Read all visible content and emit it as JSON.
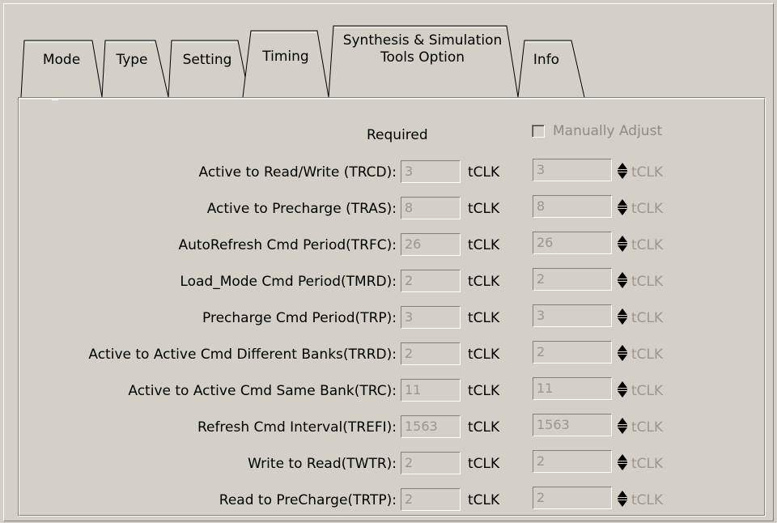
{
  "tabs": [
    {
      "label": "Mode"
    },
    {
      "label": "Type"
    },
    {
      "label": "Setting"
    },
    {
      "label": "Timing"
    },
    {
      "label_line1": "Synthesis & Simulation",
      "label_line2": "Tools Option"
    },
    {
      "label": "Info"
    }
  ],
  "active_tab": "Timing",
  "header": {
    "required_label": "Required",
    "manual_adjust_label": "Manually Adjust",
    "manual_adjust_checked": false
  },
  "rows": [
    {
      "label": "Active to Read/Write (TRCD):",
      "required": "3",
      "unit": "tCLK",
      "adjust": "3",
      "adjust_unit": "tCLK"
    },
    {
      "label": "Active to Precharge (TRAS):",
      "required": "8",
      "unit": "tCLK",
      "adjust": "8",
      "adjust_unit": "tCLK"
    },
    {
      "label": "AutoRefresh Cmd Period(TRFC):",
      "required": "26",
      "unit": "tCLK",
      "adjust": "26",
      "adjust_unit": "tCLK"
    },
    {
      "label": "Load_Mode Cmd Period(TMRD):",
      "required": "2",
      "unit": "tCLK",
      "adjust": "2",
      "adjust_unit": "tCLK"
    },
    {
      "label": "Precharge Cmd Period(TRP):",
      "required": "3",
      "unit": "tCLK",
      "adjust": "3",
      "adjust_unit": "tCLK"
    },
    {
      "label": "Active to Active Cmd Different Banks(TRRD):",
      "required": "2",
      "unit": "tCLK",
      "adjust": "2",
      "adjust_unit": "tCLK"
    },
    {
      "label": "Active to Active Cmd Same Bank(TRC):",
      "required": "11",
      "unit": "tCLK",
      "adjust": "11",
      "adjust_unit": "tCLK"
    },
    {
      "label": "Refresh Cmd Interval(TREFI):",
      "required": "1563",
      "unit": "tCLK",
      "adjust": "1563",
      "adjust_unit": "tCLK"
    },
    {
      "label": "Write to Read(TWTR):",
      "required": "2",
      "unit": "tCLK",
      "adjust": "2",
      "adjust_unit": "tCLK"
    },
    {
      "label": "Read to PreCharge(TRTP):",
      "required": "2",
      "unit": "tCLK",
      "adjust": "2",
      "adjust_unit": "tCLK"
    }
  ],
  "colors": {
    "face": "#d4d0c8",
    "disabled_text": "#9b978f",
    "shadow": "#808080",
    "highlight": "#ffffff"
  },
  "icons": {
    "spin": "spin-up-down-icon",
    "checkbox": "checkbox-unchecked-disabled"
  }
}
